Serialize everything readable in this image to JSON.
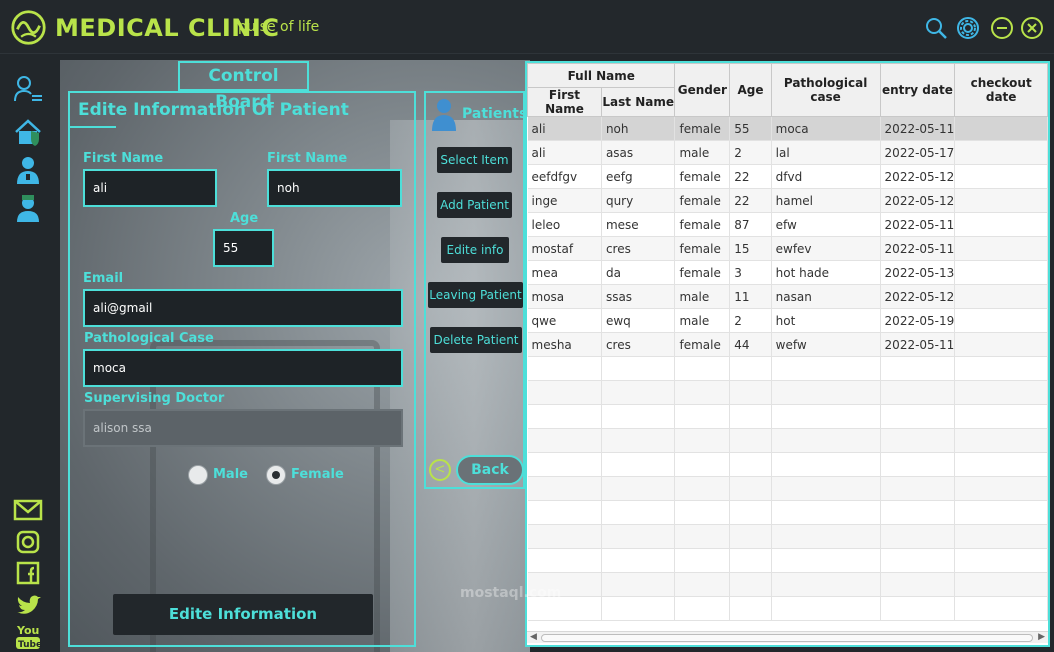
{
  "app": {
    "title": "MEDICAL CLINIC",
    "subtitle": "pulse of life",
    "accent": "#4ddfd9",
    "brand": "#b9e34a"
  },
  "main": {
    "section_title": "Control Board",
    "form": {
      "title": "Edite Information Of Patient",
      "first_name_label": "First Name",
      "first_name_value": "ali",
      "second_name_label": "First Name",
      "second_name_value": "noh",
      "age_label": "Age",
      "age_value": "55",
      "email_label": "Email",
      "email_value": "ali@gmail",
      "case_label": "Pathological Case",
      "case_value": "moca",
      "doctor_label": "Supervising Doctor",
      "doctor_value": "alison ssa",
      "gender_male": "Male",
      "gender_female": "Female",
      "gender_selected": "Female",
      "submit_label": "Edite Information"
    },
    "patients": {
      "title": "Patients",
      "buttons": [
        "Select Item",
        "Add Patient",
        "Edite info",
        "Leaving Patient",
        "Delete Patient"
      ],
      "back_label": "Back",
      "back_icon": "<"
    }
  },
  "table": {
    "group_header": "Full Name",
    "headers": [
      "First Name",
      "Last Name",
      "Gender",
      "Age",
      "Pathological case",
      "entry date",
      "checkout date"
    ],
    "rows": [
      [
        "ali",
        "noh",
        "female",
        "55",
        "moca",
        "2022-05-11",
        ""
      ],
      [
        "ali",
        "asas",
        "male",
        "2",
        "lal",
        "2022-05-17",
        ""
      ],
      [
        "eefdfgv",
        "eefg",
        "female",
        "22",
        "dfvd",
        "2022-05-12",
        ""
      ],
      [
        "inge",
        "qury",
        "female",
        "22",
        "hamel",
        "2022-05-12",
        ""
      ],
      [
        "leleo",
        "mese",
        "female",
        "87",
        "efw",
        "2022-05-11",
        ""
      ],
      [
        "mostaf",
        "cres",
        "female",
        "15",
        "ewfev",
        "2022-05-11",
        ""
      ],
      [
        "mea",
        "da",
        "female",
        "3",
        "hot hade",
        "2022-05-13",
        ""
      ],
      [
        "mosa",
        "ssas",
        "male",
        "11",
        "nasan",
        "2022-05-12",
        ""
      ],
      [
        "qwe",
        "ewq",
        "male",
        "2",
        "hot",
        "2022-05-19",
        ""
      ],
      [
        "mesha",
        "cres",
        "female",
        "44",
        "wefw",
        "2022-05-11",
        ""
      ]
    ],
    "selected_row": 0
  },
  "watermark": "mostaql.com",
  "icons": {
    "titlebar": [
      "search-icon",
      "settings-icon",
      "minimize-icon",
      "close-icon"
    ],
    "sidebar": [
      "user-list-icon",
      "home-icon",
      "doctor-icon",
      "nurse-icon"
    ],
    "social": [
      "mail-icon",
      "instagram-icon",
      "facebook-icon",
      "twitter-icon",
      "youtube-icon"
    ]
  }
}
